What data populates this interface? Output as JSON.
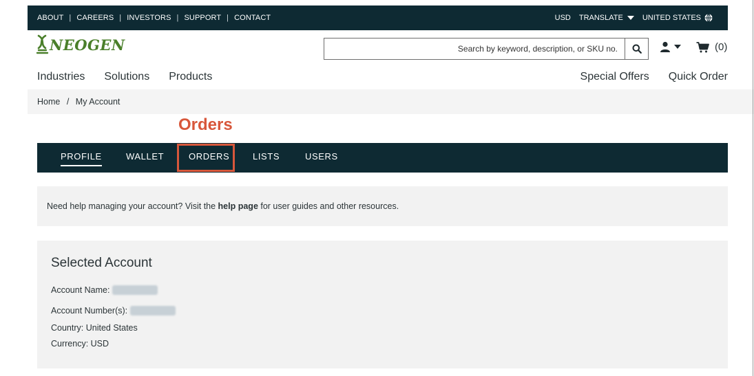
{
  "utility_bar": {
    "links": [
      "ABOUT",
      "CAREERS",
      "INVESTORS",
      "SUPPORT",
      "CONTACT"
    ],
    "currency": "USD",
    "translate": "TRANSLATE",
    "region": "UNITED STATES"
  },
  "header": {
    "logo_text": "NEOGEN",
    "search_placeholder": "Search by keyword, description, or SKU no.",
    "cart_count": "(0)"
  },
  "main_nav": {
    "items": [
      "Industries",
      "Solutions",
      "Products"
    ],
    "right_items": [
      "Special Offers",
      "Quick Order"
    ]
  },
  "breadcrumb": {
    "home": "Home",
    "separator": "/",
    "current": "My Account"
  },
  "annotation": {
    "label": "Orders",
    "color": "#d8573b"
  },
  "account_tabs": {
    "items": [
      "PROFILE",
      "WALLET",
      "ORDERS",
      "LISTS",
      "USERS"
    ],
    "active": "PROFILE",
    "highlighted": "ORDERS"
  },
  "help_banner": {
    "text_before": "Need help managing your account? Visit the ",
    "link": "help page",
    "text_after": " for user guides and other resources."
  },
  "selected_account": {
    "title": "Selected Account",
    "account_name_label": "Account Name:",
    "account_number_label": "Account Number(s):",
    "country": "Country: United States",
    "currency": "Currency: USD"
  },
  "colors": {
    "dark_teal": "#0e2a33",
    "brand_green": "#4a7f2a",
    "panel_gray": "#f2f2f2"
  }
}
